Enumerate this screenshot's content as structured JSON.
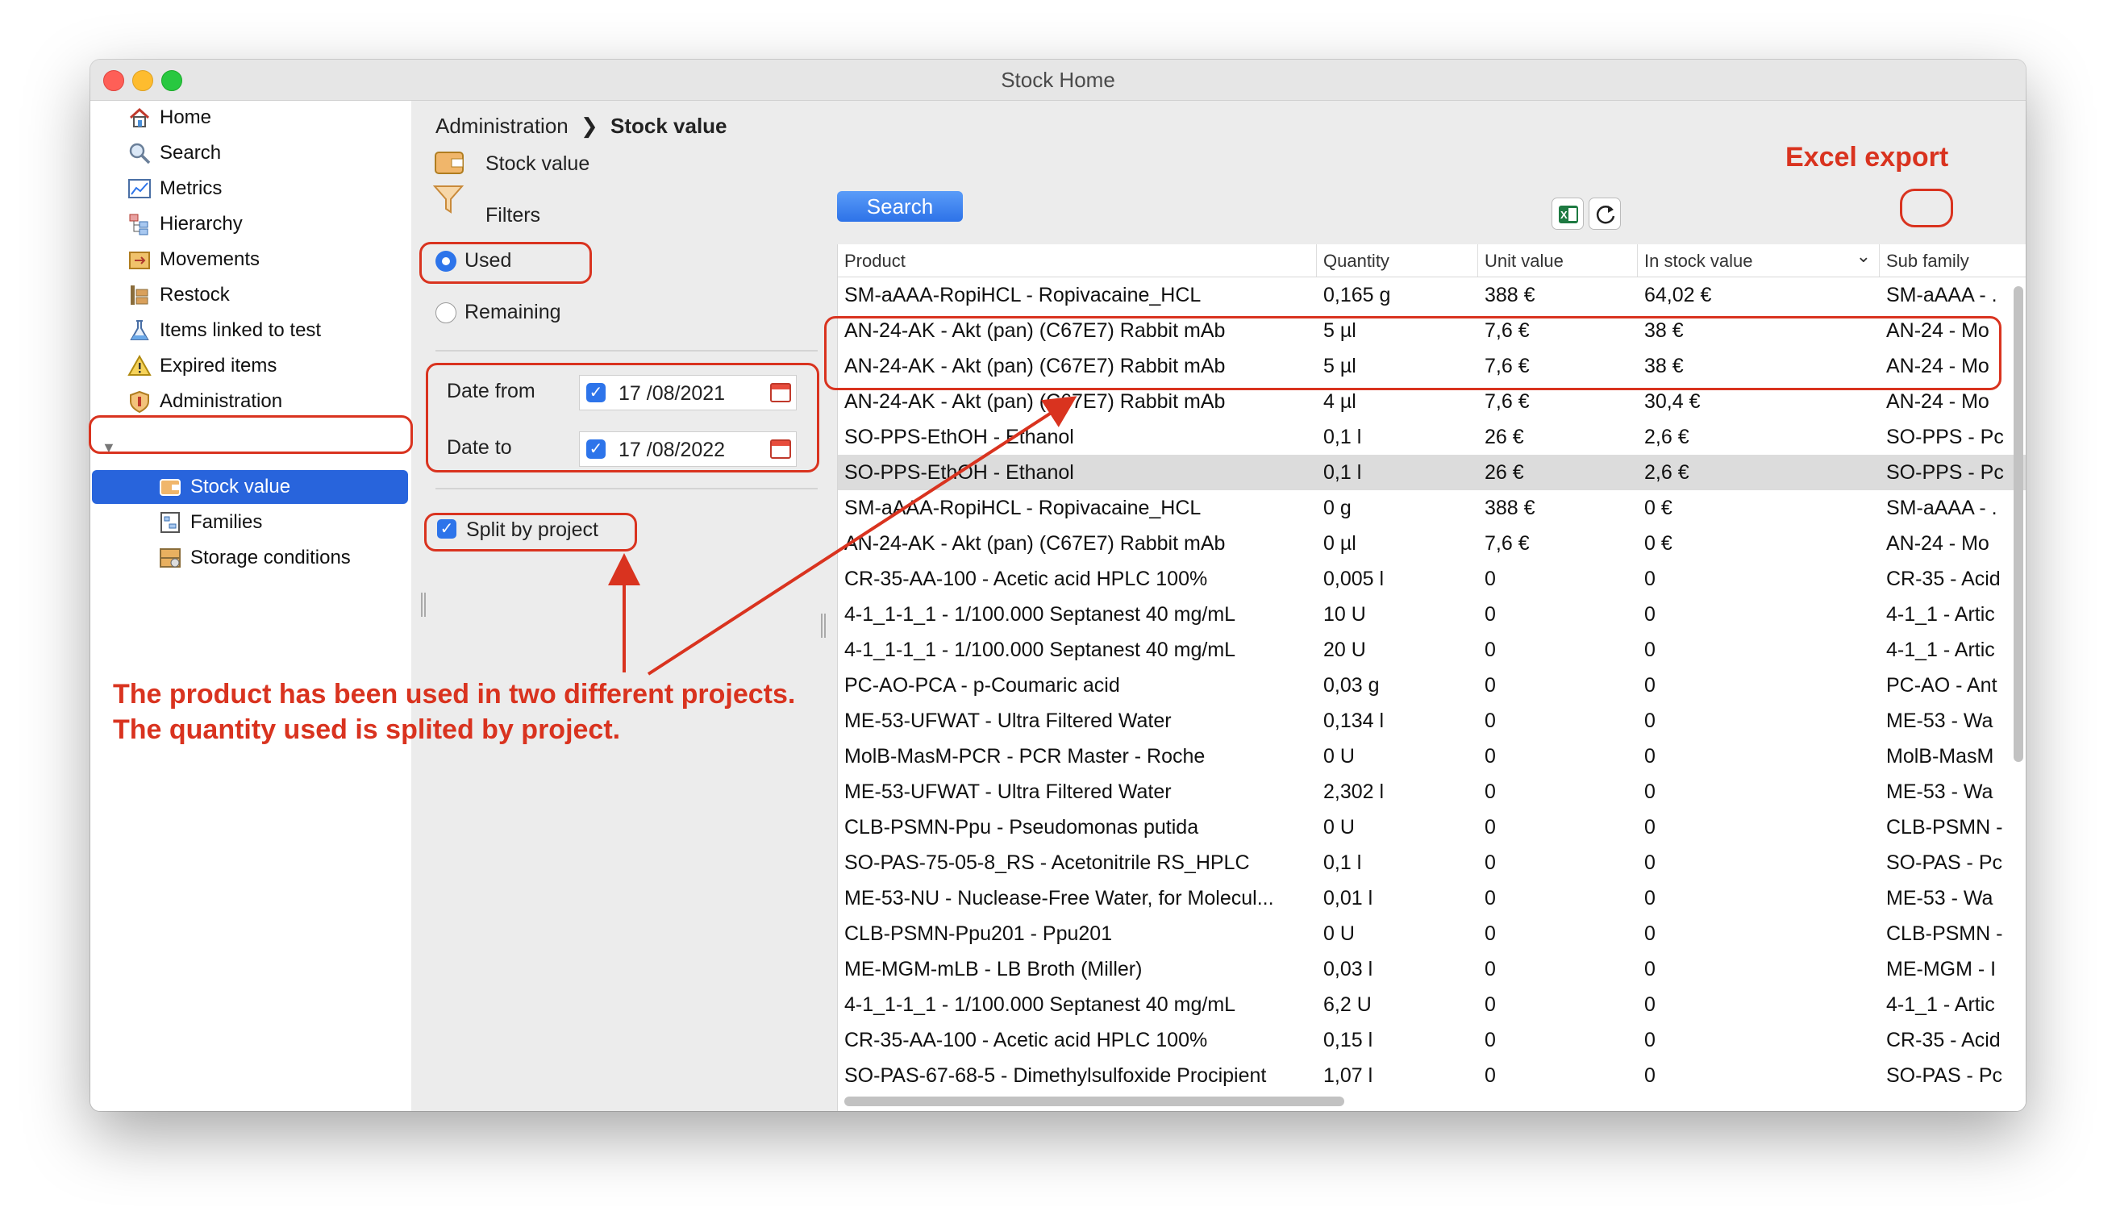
{
  "window": {
    "title": "Stock Home"
  },
  "sidebar": {
    "items": [
      {
        "label": "Home",
        "icon": "home-icon"
      },
      {
        "label": "Search",
        "icon": "magnifier-icon"
      },
      {
        "label": "Metrics",
        "icon": "chart-icon"
      },
      {
        "label": "Hierarchy",
        "icon": "hierarchy-icon"
      },
      {
        "label": "Movements",
        "icon": "movements-icon"
      },
      {
        "label": "Restock",
        "icon": "restock-icon"
      },
      {
        "label": "Items linked to test",
        "icon": "flask-icon"
      },
      {
        "label": "Expired items",
        "icon": "warning-icon"
      },
      {
        "label": "Administration",
        "icon": "shield-icon"
      },
      {
        "label": "Stock value",
        "icon": "wallet-icon"
      },
      {
        "label": "Families",
        "icon": "families-icon"
      },
      {
        "label": "Storage conditions",
        "icon": "storage-icon"
      }
    ],
    "selected": "Stock value"
  },
  "breadcrumb": {
    "parent": "Administration",
    "separator": "❯",
    "current": "Stock value"
  },
  "page": {
    "heading": "Stock value",
    "filters_label": "Filters"
  },
  "filters": {
    "mode_options": [
      {
        "label": "Used",
        "selected": true
      },
      {
        "label": "Remaining",
        "selected": false
      }
    ],
    "date_from": {
      "label": "Date from",
      "value": "17 /08/2021",
      "checked": true
    },
    "date_to": {
      "label": "Date to",
      "value": "17 /08/2022",
      "checked": true
    },
    "split_by_project": {
      "label": "Split by project",
      "checked": true
    }
  },
  "toolbar": {
    "search_label": "Search",
    "excel_icon": "excel-icon",
    "refresh_icon": "refresh-icon"
  },
  "table": {
    "columns": [
      "Product",
      "Quantity",
      "Unit value",
      "In stock value",
      "Sub family"
    ],
    "sort_indicator": "⌄",
    "rows": [
      [
        "SM-aAAA-RopiHCL - Ropivacaine_HCL",
        "0,165 g",
        "388 €",
        "64,02 €",
        "SM-aAAA - ."
      ],
      [
        "AN-24-AK - Akt (pan) (C67E7) Rabbit mAb",
        "5 µl",
        "7,6 €",
        "38 €",
        "AN-24 - Mo"
      ],
      [
        "AN-24-AK - Akt (pan) (C67E7) Rabbit mAb",
        "5 µl",
        "7,6 €",
        "38 €",
        "AN-24 - Mo"
      ],
      [
        "AN-24-AK - Akt (pan) (C67E7) Rabbit mAb",
        "4 µl",
        "7,6 €",
        "30,4 €",
        "AN-24 - Mo"
      ],
      [
        "SO-PPS-EthOH - Ethanol",
        "0,1 l",
        "26 €",
        "2,6 €",
        "SO-PPS - Pc"
      ],
      [
        "SO-PPS-EthOH - Ethanol",
        "0,1 l",
        "26 €",
        "2,6 €",
        "SO-PPS - Pc"
      ],
      [
        "SM-aAAA-RopiHCL - Ropivacaine_HCL",
        "0 g",
        "388 €",
        "0 €",
        "SM-aAAA - ."
      ],
      [
        "AN-24-AK - Akt (pan) (C67E7) Rabbit mAb",
        "0 µl",
        "7,6 €",
        "0 €",
        "AN-24 - Mo"
      ],
      [
        "CR-35-AA-100 - Acetic acid HPLC 100%",
        "0,005 l",
        "0",
        "0",
        "CR-35 - Acid"
      ],
      [
        "4-1_1-1_1 - 1/100.000 Septanest 40 mg/mL",
        "10 U",
        "0",
        "0",
        "4-1_1 - Artic"
      ],
      [
        "4-1_1-1_1 - 1/100.000 Septanest 40 mg/mL",
        "20 U",
        "0",
        "0",
        "4-1_1 - Artic"
      ],
      [
        "PC-AO-PCA - p-Coumaric acid",
        "0,03 g",
        "0",
        "0",
        "PC-AO - Ant"
      ],
      [
        "ME-53-UFWAT - Ultra Filtered Water",
        "0,134 l",
        "0",
        "0",
        "ME-53 - Wa"
      ],
      [
        "MolB-MasM-PCR - PCR Master - Roche",
        "0 U",
        "0",
        "0",
        "MolB-MasM"
      ],
      [
        "ME-53-UFWAT - Ultra Filtered Water",
        "2,302 l",
        "0",
        "0",
        "ME-53 - Wa"
      ],
      [
        "CLB-PSMN-Ppu - Pseudomonas putida",
        "0 U",
        "0",
        "0",
        "CLB-PSMN -"
      ],
      [
        "SO-PAS-75-05-8_RS - Acetonitrile RS_HPLC",
        "0,1 l",
        "0",
        "0",
        "SO-PAS - Pc"
      ],
      [
        "ME-53-NU - Nuclease-Free Water, for Molecul...",
        "0,01 l",
        "0",
        "0",
        "ME-53 - Wa"
      ],
      [
        "CLB-PSMN-Ppu201 - Ppu201",
        "0 U",
        "0",
        "0",
        "CLB-PSMN -"
      ],
      [
        "ME-MGM-mLB - LB Broth (Miller)",
        "0,03 l",
        "0",
        "0",
        "ME-MGM - I"
      ],
      [
        "4-1_1-1_1 - 1/100.000 Septanest 40 mg/mL",
        "6,2 U",
        "0",
        "0",
        "4-1_1 - Artic"
      ],
      [
        "CR-35-AA-100 - Acetic acid HPLC 100%",
        "0,15 l",
        "0",
        "0",
        "CR-35 - Acid"
      ],
      [
        "SO-PAS-67-68-5 - Dimethylsulfoxide Procipient",
        "1,07 l",
        "0",
        "0",
        "SO-PAS - Pc"
      ]
    ],
    "selected_row": 5
  },
  "annotations": {
    "excel_export": "Excel export",
    "note_line1": "The product has been used in two different projects.",
    "note_line2": "The quantity used is splited by project.",
    "color": "#d9331f"
  }
}
